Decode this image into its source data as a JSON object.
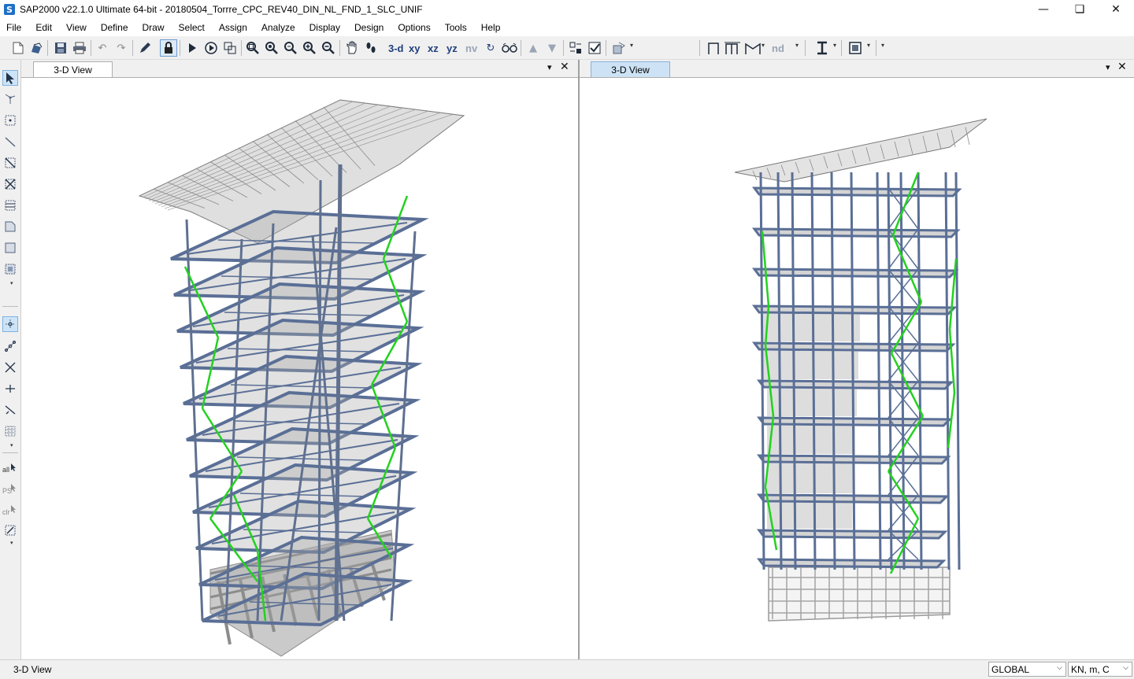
{
  "window": {
    "title": "SAP2000 v22.1.0 Ultimate 64-bit - 20180504_Torrre_CPC_REV40_DIN_NL_FND_1_SLC_UNIF",
    "app_icon_letter": "S",
    "minimize": "—",
    "restore": "❏",
    "close": "✕"
  },
  "menu": [
    "File",
    "Edit",
    "View",
    "Define",
    "Draw",
    "Select",
    "Assign",
    "Analyze",
    "Display",
    "Design",
    "Options",
    "Tools",
    "Help"
  ],
  "toolbar": {
    "view_3d": "3-d",
    "view_xy": "xy",
    "view_xz": "xz",
    "view_yz": "yz",
    "view_nv": "nv",
    "nd": "nd"
  },
  "left_tools": {
    "all": "all",
    "ps": "PS",
    "clr": "clr"
  },
  "panes": {
    "left": {
      "tab_label": "3-D View",
      "dropdown": "▾",
      "close": "✕"
    },
    "right": {
      "tab_label": "3-D View",
      "dropdown": "▾",
      "close": "✕"
    }
  },
  "status": {
    "text": "3-D View",
    "coord_system": "GLOBAL",
    "units": "KN, m, C"
  },
  "colors": {
    "frame_steel_blue": "#5a6f96",
    "brace_green": "#22d21e",
    "floor_slab_grey": "#a9a9a9",
    "foundation_grey": "#8c8c8c",
    "active_tab": "#cde3f5",
    "app_icon_blue": "#1e6fc7"
  },
  "icons": {
    "new": "new-model-icon",
    "open": "open-icon",
    "save": "save-icon",
    "print": "print-icon",
    "undo": "undo-icon",
    "redo": "redo-icon",
    "edit": "pencil-icon",
    "lock": "lock-icon",
    "run": "run-analysis-icon"
  }
}
